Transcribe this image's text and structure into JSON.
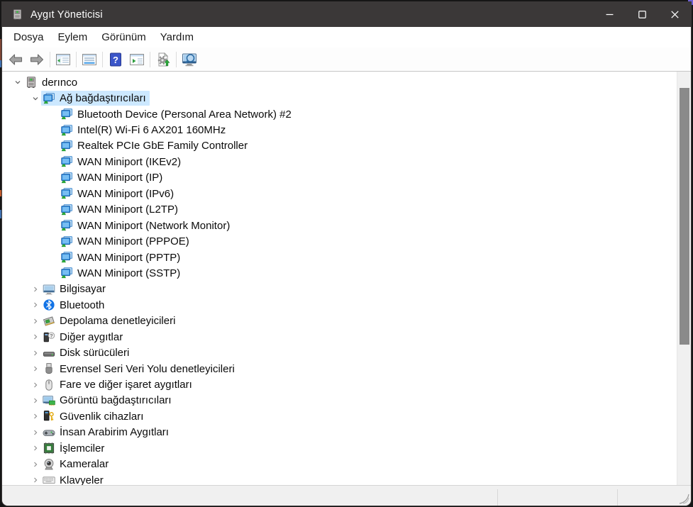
{
  "window": {
    "title": "Aygıt Yöneticisi",
    "app_icon": "device-manager"
  },
  "titlebar_controls": [
    {
      "key": "minimize",
      "icon": "minimize"
    },
    {
      "key": "maximize",
      "icon": "maximize"
    },
    {
      "key": "close",
      "icon": "close"
    }
  ],
  "menu": {
    "items": [
      {
        "key": "dosya",
        "label": "Dosya"
      },
      {
        "key": "eylem",
        "label": "Eylem"
      },
      {
        "key": "gorunum",
        "label": "Görünüm"
      },
      {
        "key": "yardim",
        "label": "Yardım"
      }
    ]
  },
  "toolbar": {
    "buttons": [
      {
        "key": "back",
        "icon": "back-arrow",
        "sep_after": false
      },
      {
        "key": "forward",
        "icon": "forward-arrow",
        "sep_after": true
      },
      {
        "key": "console-tree",
        "icon": "console-tree",
        "sep_after": true
      },
      {
        "key": "properties",
        "icon": "properties",
        "sep_after": true
      },
      {
        "key": "help",
        "icon": "help",
        "sep_after": false
      },
      {
        "key": "action-pane",
        "icon": "action-pane",
        "sep_after": true
      },
      {
        "key": "scan-hardware-changes",
        "icon": "scan-hardware",
        "sep_after": true
      },
      {
        "key": "search-computer",
        "icon": "search-computer",
        "sep_after": false
      }
    ]
  },
  "tree": {
    "items": [
      {
        "label": "derınco",
        "level": 0,
        "icon": "device-manager",
        "chevron": "expanded",
        "selected": false
      },
      {
        "label": "Ağ bağdaştırıcıları",
        "level": 1,
        "icon": "network-adapter",
        "chevron": "expanded",
        "selected": true
      },
      {
        "label": "Bluetooth Device (Personal Area Network) #2",
        "level": 2,
        "icon": "network-adapter",
        "chevron": null,
        "selected": false
      },
      {
        "label": "Intel(R) Wi-Fi 6 AX201 160MHz",
        "level": 2,
        "icon": "network-adapter",
        "chevron": null,
        "selected": false
      },
      {
        "label": "Realtek PCIe GbE Family Controller",
        "level": 2,
        "icon": "network-adapter",
        "chevron": null,
        "selected": false
      },
      {
        "label": "WAN Miniport (IKEv2)",
        "level": 2,
        "icon": "network-adapter",
        "chevron": null,
        "selected": false
      },
      {
        "label": "WAN Miniport (IP)",
        "level": 2,
        "icon": "network-adapter",
        "chevron": null,
        "selected": false
      },
      {
        "label": "WAN Miniport (IPv6)",
        "level": 2,
        "icon": "network-adapter",
        "chevron": null,
        "selected": false
      },
      {
        "label": "WAN Miniport (L2TP)",
        "level": 2,
        "icon": "network-adapter",
        "chevron": null,
        "selected": false
      },
      {
        "label": "WAN Miniport (Network Monitor)",
        "level": 2,
        "icon": "network-adapter",
        "chevron": null,
        "selected": false
      },
      {
        "label": "WAN Miniport (PPPOE)",
        "level": 2,
        "icon": "network-adapter",
        "chevron": null,
        "selected": false
      },
      {
        "label": "WAN Miniport (PPTP)",
        "level": 2,
        "icon": "network-adapter",
        "chevron": null,
        "selected": false
      },
      {
        "label": "WAN Miniport (SSTP)",
        "level": 2,
        "icon": "network-adapter",
        "chevron": null,
        "selected": false
      },
      {
        "label": "Bilgisayar",
        "level": 1,
        "icon": "computer",
        "chevron": "collapsed",
        "selected": false
      },
      {
        "label": "Bluetooth",
        "level": 1,
        "icon": "bluetooth",
        "chevron": "collapsed",
        "selected": false
      },
      {
        "label": "Depolama denetleyicileri",
        "level": 1,
        "icon": "storage",
        "chevron": "collapsed",
        "selected": false
      },
      {
        "label": "Diğer aygıtlar",
        "level": 1,
        "icon": "other-devices",
        "chevron": "collapsed",
        "selected": false
      },
      {
        "label": "Disk sürücüleri",
        "level": 1,
        "icon": "disk",
        "chevron": "collapsed",
        "selected": false
      },
      {
        "label": "Evrensel Seri Veri Yolu denetleyicileri",
        "level": 1,
        "icon": "usb",
        "chevron": "collapsed",
        "selected": false
      },
      {
        "label": "Fare ve diğer işaret aygıtları",
        "level": 1,
        "icon": "mouse",
        "chevron": "collapsed",
        "selected": false
      },
      {
        "label": "Görüntü bağdaştırıcıları",
        "level": 1,
        "icon": "display",
        "chevron": "collapsed",
        "selected": false
      },
      {
        "label": "Güvenlik cihazları",
        "level": 1,
        "icon": "security",
        "chevron": "collapsed",
        "selected": false
      },
      {
        "label": "İnsan Arabirim Aygıtları",
        "level": 1,
        "icon": "hid",
        "chevron": "collapsed",
        "selected": false
      },
      {
        "label": "İşlemciler",
        "level": 1,
        "icon": "cpu",
        "chevron": "collapsed",
        "selected": false
      },
      {
        "label": "Kameralar",
        "level": 1,
        "icon": "camera",
        "chevron": "collapsed",
        "selected": false
      },
      {
        "label": "Klavyeler",
        "level": 1,
        "icon": "keyboard",
        "chevron": "collapsed",
        "selected": false
      }
    ]
  },
  "colors": {
    "titlebar_bg": "#3b3838",
    "titlebar_text": "#ffffff",
    "selection_bg": "#cce8ff",
    "statusbar_bg": "#f0f0f0",
    "scrollbar_thumb": "#8a8a8a",
    "help_button_blue": "#3a55c9",
    "tree_text": "#0a0a0a"
  }
}
